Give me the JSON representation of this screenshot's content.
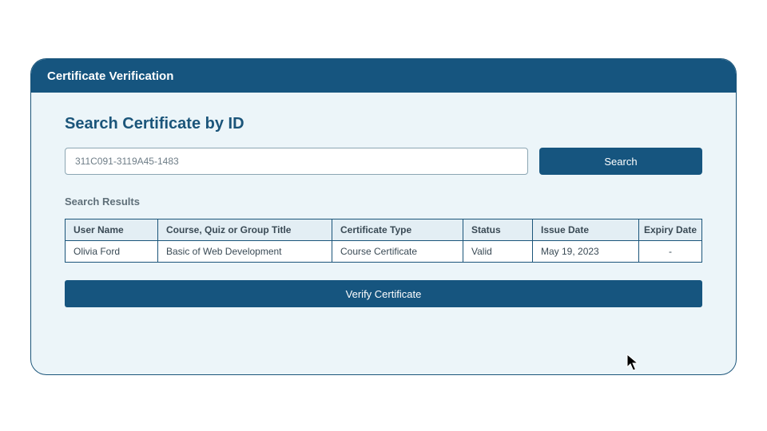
{
  "header": {
    "title": "Certificate Verification"
  },
  "search": {
    "section_title": "Search Certificate by ID",
    "input_value": "311C091-3119A45-1483",
    "button_label": "Search"
  },
  "results": {
    "label": "Search Results",
    "columns": {
      "user": "User Name",
      "course": "Course, Quiz or Group Title",
      "type": "Certificate Type",
      "status": "Status",
      "issue": "Issue Date",
      "expiry": "Expiry Date"
    },
    "row": {
      "user": "Olivia Ford",
      "course": "Basic of Web Development",
      "type": "Course Certificate",
      "status": "Valid",
      "issue": "May 19, 2023",
      "expiry": "-"
    }
  },
  "verify": {
    "button_label": "Verify Certificate"
  }
}
